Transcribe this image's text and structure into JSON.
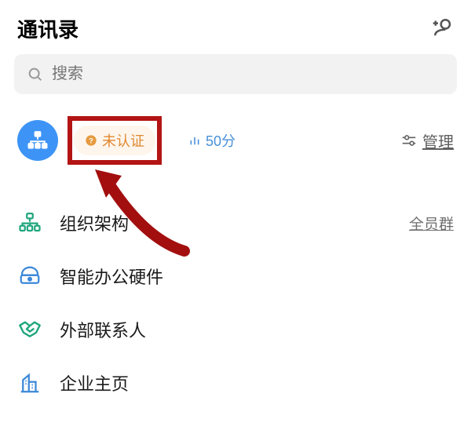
{
  "header": {
    "title": "通讯录"
  },
  "search": {
    "placeholder": "搜索"
  },
  "org": {
    "verify_badge": "未认证",
    "score_label": "50分",
    "manage_label": "管理"
  },
  "list": {
    "org_structure": {
      "label": "组织架构",
      "right_link": "全员群"
    },
    "smart_hardware": {
      "label": "智能办公硬件"
    },
    "external_contacts": {
      "label": "外部联系人"
    },
    "company_page": {
      "label": "企业主页"
    }
  }
}
